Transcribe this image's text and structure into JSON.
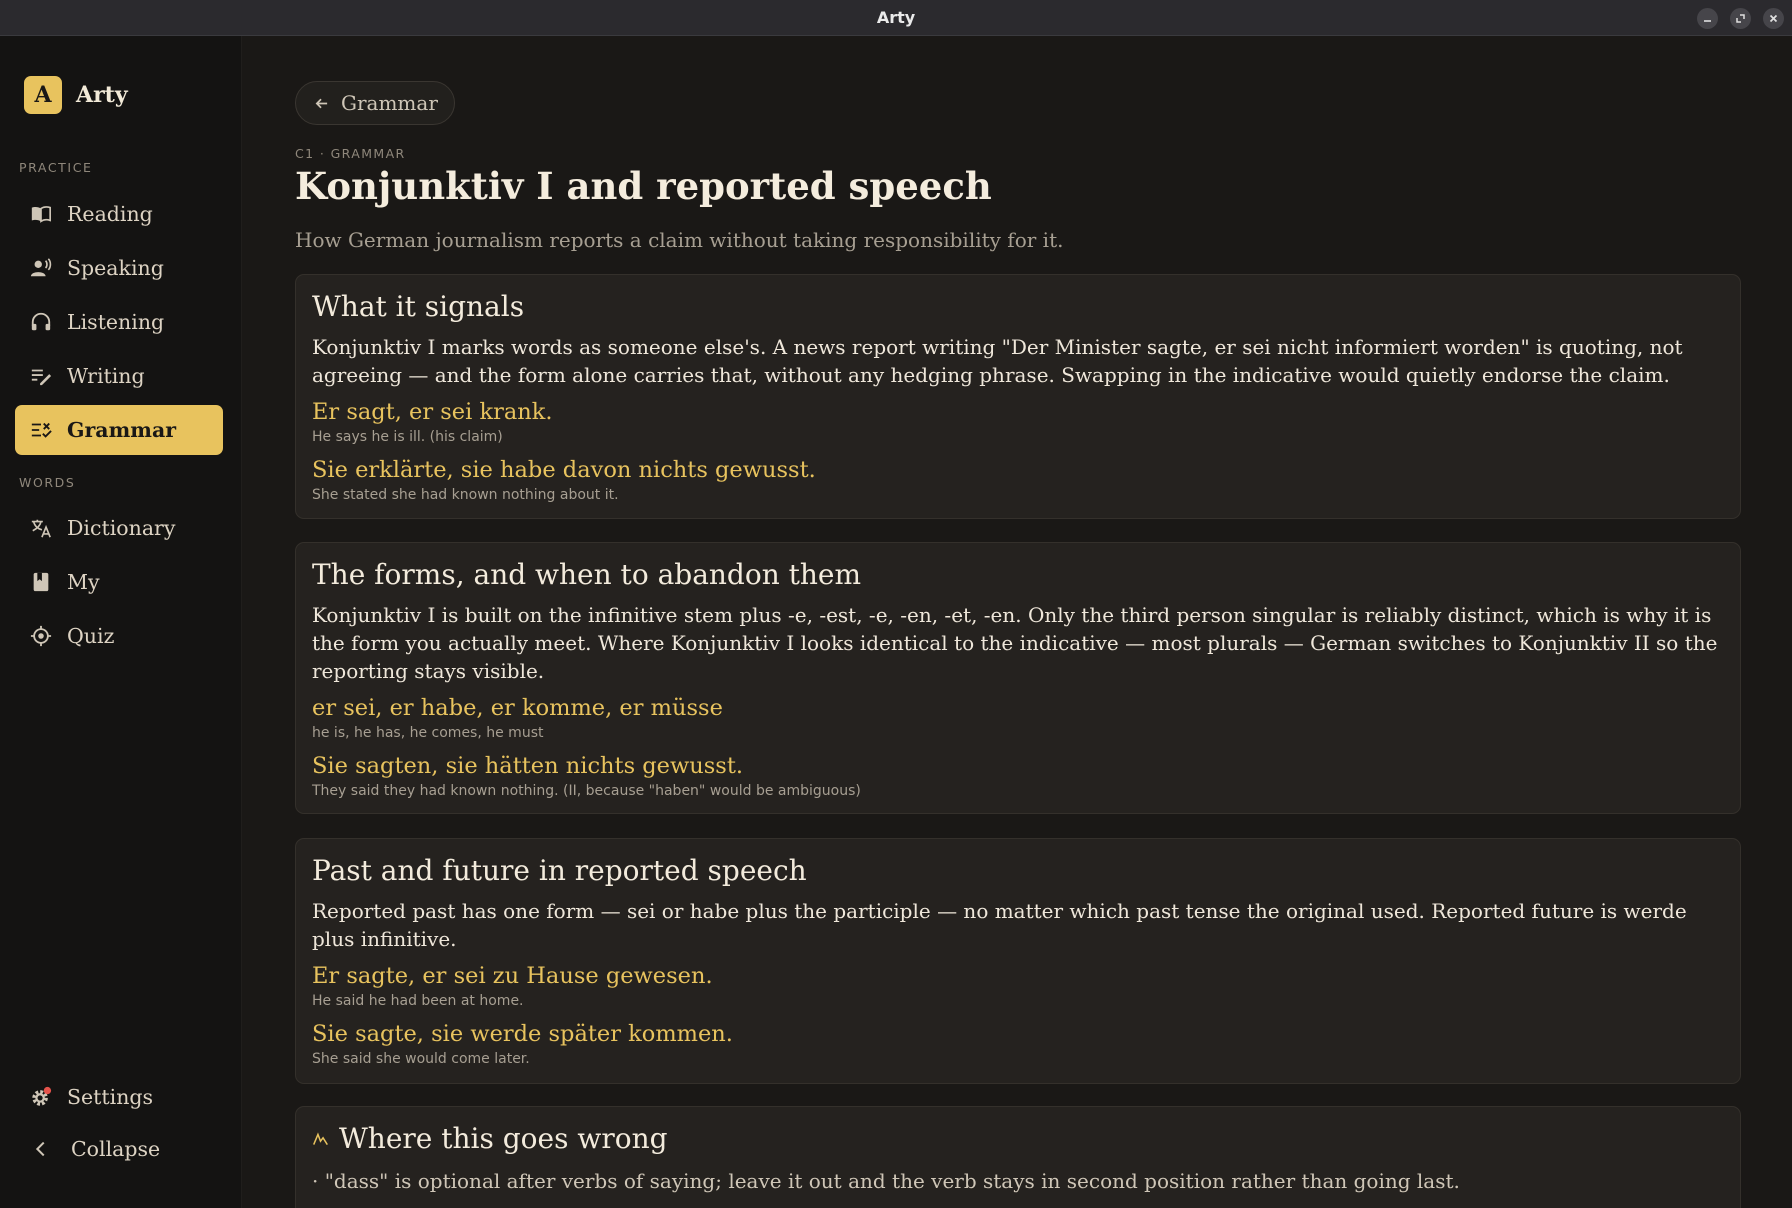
{
  "window": {
    "title": "Arty"
  },
  "sidebar": {
    "brand": {
      "badge": "A",
      "name": "Arty"
    },
    "practice_label": "PRACTICE",
    "practice_items": [
      {
        "label": "Reading",
        "icon": "book-icon"
      },
      {
        "label": "Speaking",
        "icon": "speaking-icon"
      },
      {
        "label": "Listening",
        "icon": "headphones-icon"
      },
      {
        "label": "Writing",
        "icon": "writing-icon"
      },
      {
        "label": "Grammar",
        "icon": "grammar-icon",
        "active": true
      }
    ],
    "words_label": "WORDS",
    "words_items": [
      {
        "label": "Dictionary",
        "icon": "translate-icon"
      },
      {
        "label": "My",
        "icon": "bookmark-book-icon"
      },
      {
        "label": "Quiz",
        "icon": "target-icon"
      }
    ],
    "settings_label": "Settings",
    "collapse_label": "Collapse"
  },
  "colors": {
    "accent": "#e8c35e",
    "background": "#1a1816",
    "card": "#25221f",
    "notification": "#e5534b"
  },
  "main": {
    "back_label": "Grammar",
    "eyebrow": "C1 · GRAMMAR",
    "title": "Konjunktiv I and reported speech",
    "subtitle": "How German journalism reports a claim without taking responsibility for it.",
    "sections": [
      {
        "heading": "What it signals",
        "body": "Konjunktiv I marks words as someone else's. A news report writing \"Der Minister sagte, er sei nicht informiert worden\" is quoting, not agreeing — and the form alone carries that, without any hedging phrase. Swapping in the indicative would quietly endorse the claim.",
        "examples": [
          {
            "de": "Er sagt, er sei krank.",
            "en": "He says he is ill. (his claim)"
          },
          {
            "de": "Sie erklärte, sie habe davon nichts gewusst.",
            "en": "She stated she had known nothing about it."
          }
        ]
      },
      {
        "heading": "The forms, and when to abandon them",
        "body": "Konjunktiv I is built on the infinitive stem plus -e, -est, -e, -en, -et, -en. Only the third person singular is reliably distinct, which is why it is the form you actually meet. Where Konjunktiv I looks identical to the indicative — most plurals — German switches to Konjunktiv II so the reporting stays visible.",
        "examples": [
          {
            "de": "er sei, er habe, er komme, er müsse",
            "en": "he is, he has, he comes, he must"
          },
          {
            "de": "Sie sagten, sie hätten nichts gewusst.",
            "en": "They said they had known nothing. (II, because \"haben\" would be ambiguous)"
          }
        ]
      },
      {
        "heading": "Past and future in reported speech",
        "body": "Reported past has one form — sei or habe plus the participle — no matter which past tense the original used. Reported future is werde plus infinitive.",
        "examples": [
          {
            "de": "Er sagte, er sei zu Hause gewesen.",
            "en": "He said he had been at home."
          },
          {
            "de": "Sie sagte, sie werde später kommen.",
            "en": "She said she would come later."
          }
        ]
      },
      {
        "heading": "Where this goes wrong",
        "bullet": "· \"dass\" is optional after verbs of saying; leave it out and the verb stays in second position rather than going last."
      }
    ]
  }
}
